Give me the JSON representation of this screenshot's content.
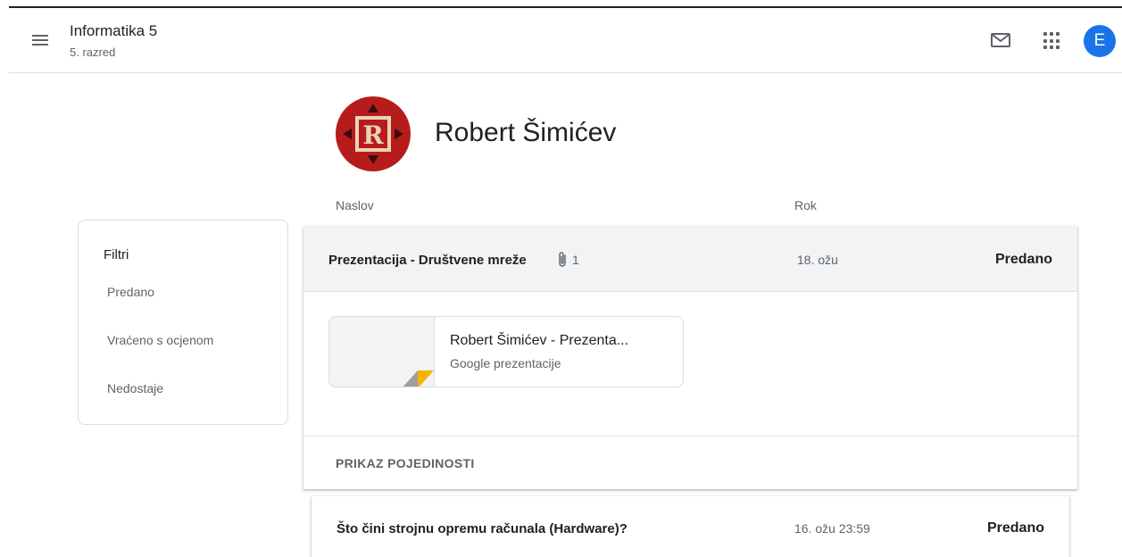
{
  "header": {
    "class_title": "Informatika 5",
    "class_subtitle": "5. razred",
    "user_initial": "E"
  },
  "student": {
    "name": "Robert Šimićev",
    "avatar_letter": "R"
  },
  "columns": {
    "title": "Naslov",
    "due": "Rok"
  },
  "filters": {
    "title": "Filtri",
    "items": [
      "Predano",
      "Vraćeno s ocjenom",
      "Nedostaje"
    ]
  },
  "assignments": [
    {
      "title": "Prezentacija - Društvene mreže",
      "attachment_count": "1",
      "due": "18. ožu",
      "status": "Predano",
      "attachment": {
        "name": "Robert Šimićev - Prezenta...",
        "type": "Google prezentacije"
      },
      "details_label": "PRIKAZ POJEDINOSTI"
    },
    {
      "title": "Što čini strojnu opremu računala (Hardware)?",
      "due": "16. ožu 23:59",
      "status": "Predano"
    }
  ],
  "colors": {
    "accent": "#1a73e8",
    "avatar_bg": "#b71c1c",
    "slides_yellow": "#f4b400"
  },
  "icons": {
    "menu": "menu-icon",
    "mail": "mail-icon",
    "apps": "apps-grid-icon",
    "attachment": "paperclip-icon",
    "slides": "google-slides-icon"
  }
}
